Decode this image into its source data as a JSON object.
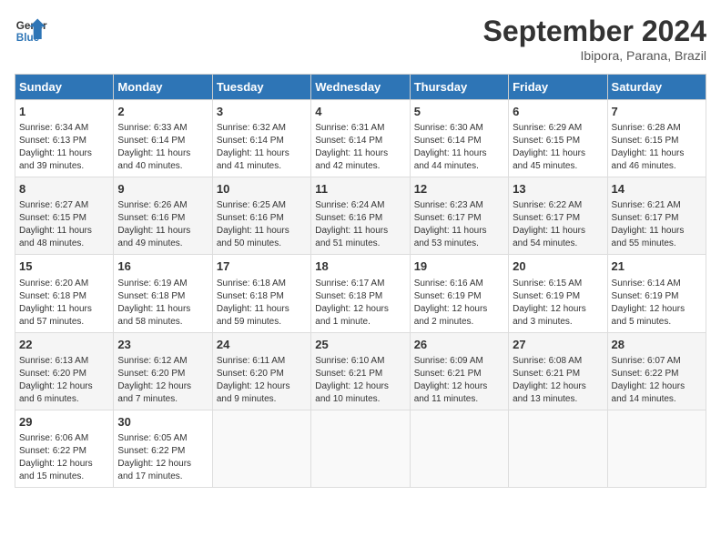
{
  "header": {
    "logo_line1": "General",
    "logo_line2": "Blue",
    "month": "September 2024",
    "location": "Ibipora, Parana, Brazil"
  },
  "days_of_week": [
    "Sunday",
    "Monday",
    "Tuesday",
    "Wednesday",
    "Thursday",
    "Friday",
    "Saturday"
  ],
  "weeks": [
    [
      {
        "day": "1",
        "info": "Sunrise: 6:34 AM\nSunset: 6:13 PM\nDaylight: 11 hours\nand 39 minutes."
      },
      {
        "day": "2",
        "info": "Sunrise: 6:33 AM\nSunset: 6:14 PM\nDaylight: 11 hours\nand 40 minutes."
      },
      {
        "day": "3",
        "info": "Sunrise: 6:32 AM\nSunset: 6:14 PM\nDaylight: 11 hours\nand 41 minutes."
      },
      {
        "day": "4",
        "info": "Sunrise: 6:31 AM\nSunset: 6:14 PM\nDaylight: 11 hours\nand 42 minutes."
      },
      {
        "day": "5",
        "info": "Sunrise: 6:30 AM\nSunset: 6:14 PM\nDaylight: 11 hours\nand 44 minutes."
      },
      {
        "day": "6",
        "info": "Sunrise: 6:29 AM\nSunset: 6:15 PM\nDaylight: 11 hours\nand 45 minutes."
      },
      {
        "day": "7",
        "info": "Sunrise: 6:28 AM\nSunset: 6:15 PM\nDaylight: 11 hours\nand 46 minutes."
      }
    ],
    [
      {
        "day": "8",
        "info": "Sunrise: 6:27 AM\nSunset: 6:15 PM\nDaylight: 11 hours\nand 48 minutes."
      },
      {
        "day": "9",
        "info": "Sunrise: 6:26 AM\nSunset: 6:16 PM\nDaylight: 11 hours\nand 49 minutes."
      },
      {
        "day": "10",
        "info": "Sunrise: 6:25 AM\nSunset: 6:16 PM\nDaylight: 11 hours\nand 50 minutes."
      },
      {
        "day": "11",
        "info": "Sunrise: 6:24 AM\nSunset: 6:16 PM\nDaylight: 11 hours\nand 51 minutes."
      },
      {
        "day": "12",
        "info": "Sunrise: 6:23 AM\nSunset: 6:17 PM\nDaylight: 11 hours\nand 53 minutes."
      },
      {
        "day": "13",
        "info": "Sunrise: 6:22 AM\nSunset: 6:17 PM\nDaylight: 11 hours\nand 54 minutes."
      },
      {
        "day": "14",
        "info": "Sunrise: 6:21 AM\nSunset: 6:17 PM\nDaylight: 11 hours\nand 55 minutes."
      }
    ],
    [
      {
        "day": "15",
        "info": "Sunrise: 6:20 AM\nSunset: 6:18 PM\nDaylight: 11 hours\nand 57 minutes."
      },
      {
        "day": "16",
        "info": "Sunrise: 6:19 AM\nSunset: 6:18 PM\nDaylight: 11 hours\nand 58 minutes."
      },
      {
        "day": "17",
        "info": "Sunrise: 6:18 AM\nSunset: 6:18 PM\nDaylight: 11 hours\nand 59 minutes."
      },
      {
        "day": "18",
        "info": "Sunrise: 6:17 AM\nSunset: 6:18 PM\nDaylight: 12 hours\nand 1 minute."
      },
      {
        "day": "19",
        "info": "Sunrise: 6:16 AM\nSunset: 6:19 PM\nDaylight: 12 hours\nand 2 minutes."
      },
      {
        "day": "20",
        "info": "Sunrise: 6:15 AM\nSunset: 6:19 PM\nDaylight: 12 hours\nand 3 minutes."
      },
      {
        "day": "21",
        "info": "Sunrise: 6:14 AM\nSunset: 6:19 PM\nDaylight: 12 hours\nand 5 minutes."
      }
    ],
    [
      {
        "day": "22",
        "info": "Sunrise: 6:13 AM\nSunset: 6:20 PM\nDaylight: 12 hours\nand 6 minutes."
      },
      {
        "day": "23",
        "info": "Sunrise: 6:12 AM\nSunset: 6:20 PM\nDaylight: 12 hours\nand 7 minutes."
      },
      {
        "day": "24",
        "info": "Sunrise: 6:11 AM\nSunset: 6:20 PM\nDaylight: 12 hours\nand 9 minutes."
      },
      {
        "day": "25",
        "info": "Sunrise: 6:10 AM\nSunset: 6:21 PM\nDaylight: 12 hours\nand 10 minutes."
      },
      {
        "day": "26",
        "info": "Sunrise: 6:09 AM\nSunset: 6:21 PM\nDaylight: 12 hours\nand 11 minutes."
      },
      {
        "day": "27",
        "info": "Sunrise: 6:08 AM\nSunset: 6:21 PM\nDaylight: 12 hours\nand 13 minutes."
      },
      {
        "day": "28",
        "info": "Sunrise: 6:07 AM\nSunset: 6:22 PM\nDaylight: 12 hours\nand 14 minutes."
      }
    ],
    [
      {
        "day": "29",
        "info": "Sunrise: 6:06 AM\nSunset: 6:22 PM\nDaylight: 12 hours\nand 15 minutes."
      },
      {
        "day": "30",
        "info": "Sunrise: 6:05 AM\nSunset: 6:22 PM\nDaylight: 12 hours\nand 17 minutes."
      },
      {
        "day": "",
        "info": ""
      },
      {
        "day": "",
        "info": ""
      },
      {
        "day": "",
        "info": ""
      },
      {
        "day": "",
        "info": ""
      },
      {
        "day": "",
        "info": ""
      }
    ]
  ]
}
